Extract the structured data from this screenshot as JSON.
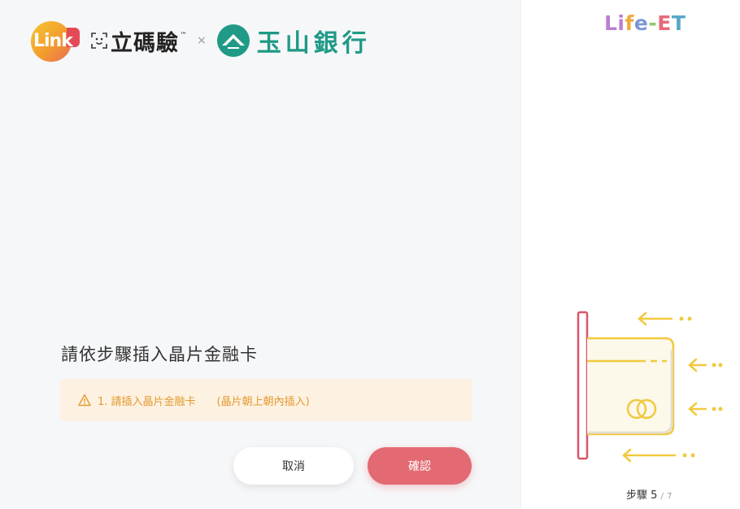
{
  "header": {
    "link_logo_text": "Link",
    "brand_name": "立碼驗",
    "trademark": "™",
    "times": "×",
    "bank_name": "玉山銀行"
  },
  "main": {
    "title": "請依步驟插入晶片金融卡",
    "warning": {
      "step_text": "1. 請插入晶片金融卡",
      "note": "(晶片朝上朝內插入)"
    },
    "buttons": {
      "cancel": "取消",
      "confirm": "確認"
    }
  },
  "sidebar": {
    "logo_parts": [
      "Li",
      "f",
      "e",
      "-",
      "E",
      "T"
    ],
    "step_label": "步驟",
    "step_current": "5",
    "step_separator": "/",
    "step_total": "7"
  },
  "colors": {
    "accent": "#e36a72",
    "warning_text": "#e39a2b",
    "warning_bg": "#fdf1e2",
    "bank_green": "#1f9a86",
    "card_yellow": "#f1c93f"
  },
  "icons": {
    "face_scan": "face-scan-icon",
    "mountain": "mountain-logo-icon",
    "warning": "warning-triangle-icon",
    "card": "chip-card-icon"
  }
}
